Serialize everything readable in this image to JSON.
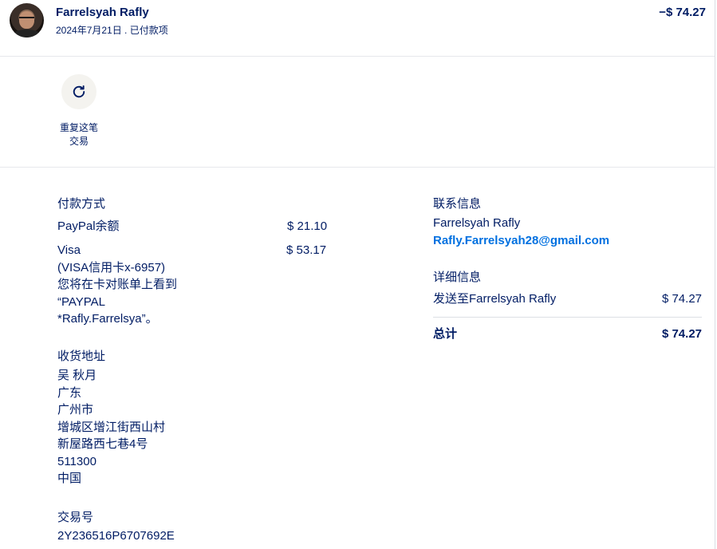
{
  "header": {
    "name": "Farrelsyah Rafly",
    "date_status": "2024年7月21日 . 已付款项",
    "amount": "−$ 74.27"
  },
  "actions": {
    "repeat_label_line1": "重复这笔",
    "repeat_label_line2": "交易",
    "repeat_icon": "refresh-icon"
  },
  "payment": {
    "title": "付款方式",
    "paypal_label": "PayPal余额",
    "paypal_amount": "$ 21.10",
    "visa_label": "Visa",
    "visa_amount": "$ 53.17",
    "visa_note_1": "(VISA信用卡x-6957)",
    "visa_note_2": "您将在卡对账单上看到",
    "visa_note_3": "“PAYPAL",
    "visa_note_4": "*Rafly.Farrelsya”。"
  },
  "shipping": {
    "title": "收货地址",
    "line1": "吴 秋月",
    "line2": "广东",
    "line3": "广州市",
    "line4": "增城区增江街西山村",
    "line5": "新屋路西七巷4号",
    "line6": "511300",
    "line7": "中国"
  },
  "transaction": {
    "title": "交易号",
    "id": "2Y236516P6707692E"
  },
  "contact": {
    "title": "联系信息",
    "name": "Farrelsyah Rafly",
    "email": "Rafly.Farrelsyah28@gmail.com"
  },
  "details": {
    "title": "详细信息",
    "sent_label": "发送至Farrelsyah Rafly",
    "sent_amount": "$ 74.27",
    "total_label": "总计",
    "total_amount": "$ 74.27"
  },
  "colors": {
    "text": "#001c64",
    "link": "#0070e0",
    "button_bg": "#f4f3ef"
  }
}
